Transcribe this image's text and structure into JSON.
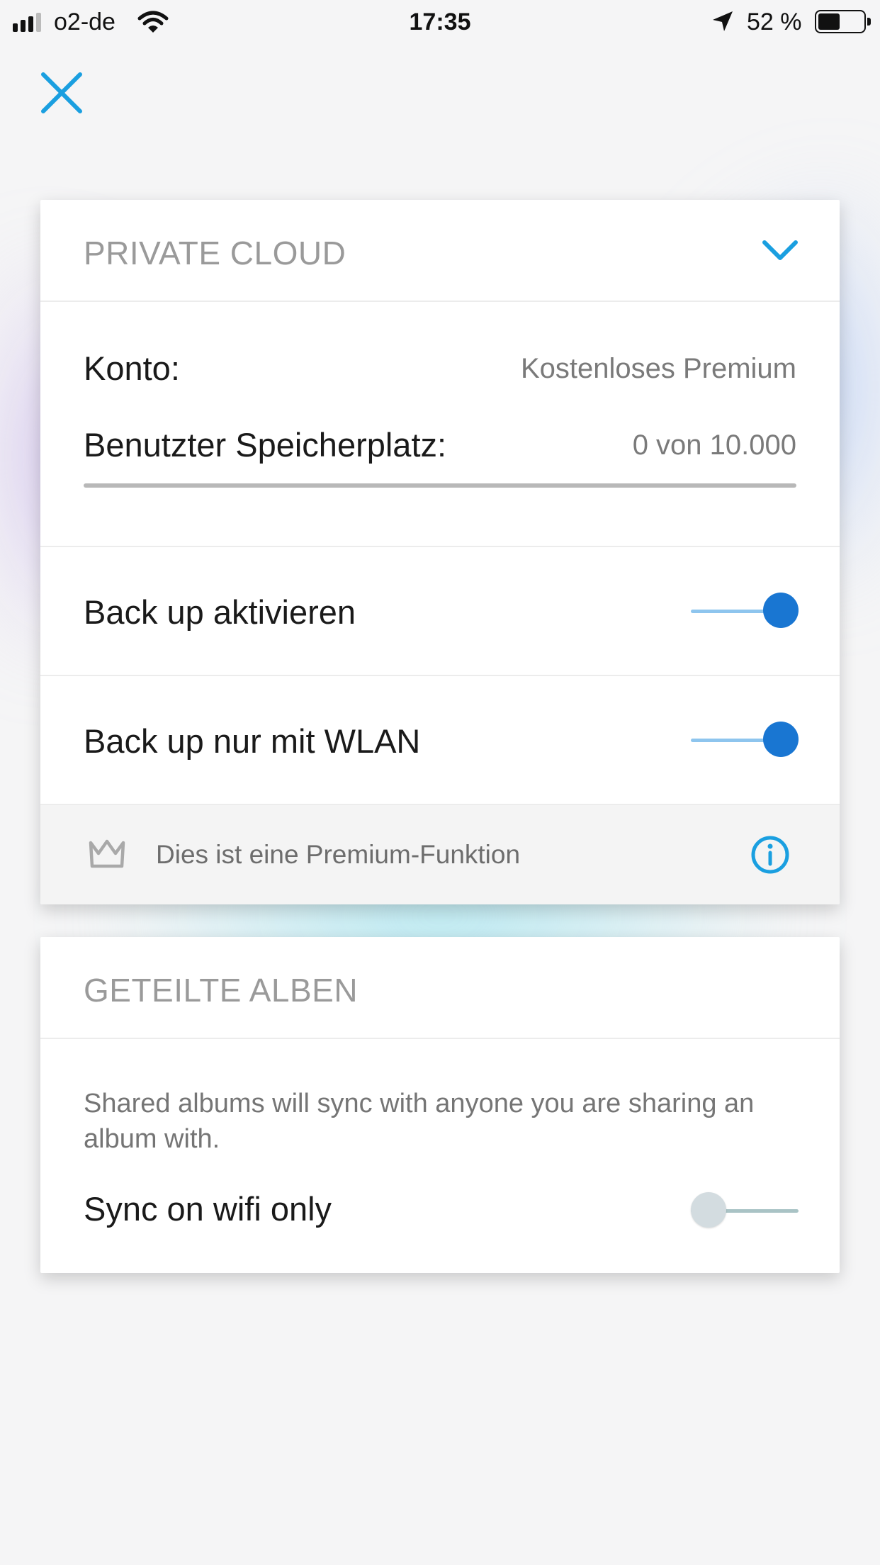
{
  "status_bar": {
    "carrier": "o2-de",
    "time": "17:35",
    "battery_percent": "52 %",
    "battery_level": 0.52,
    "signal_bars": 3,
    "icons": [
      "signal-icon",
      "wifi-icon",
      "location-arrow-icon",
      "battery-icon"
    ]
  },
  "toolbar": {
    "close_icon": "close-icon"
  },
  "private_cloud": {
    "title": "PRIVATE CLOUD",
    "expand_icon": "chevron-down-icon",
    "account_label": "Konto:",
    "account_value": "Kostenloses Premium",
    "storage_label": "Benutzter Speicherplatz:",
    "storage_value": "0 von 10.000",
    "storage_used_fraction": 0,
    "backup_label": "Back up aktivieren",
    "backup_enabled": true,
    "wlan_label": "Back up nur mit WLAN",
    "wlan_enabled": true,
    "premium_text": "Dies ist eine Premium-Funktion",
    "premium_icon": "crown-icon",
    "info_icon": "info-icon"
  },
  "shared_albums": {
    "title": "GETEILTE ALBEN",
    "description": "Shared albums will sync with anyone you are sharing an album with.",
    "sync_label": "Sync on wifi only",
    "sync_enabled": false
  },
  "colors": {
    "accent": "#1976d2",
    "icon_blue": "#1a9fe0",
    "header_gray": "#9a9a9a"
  }
}
